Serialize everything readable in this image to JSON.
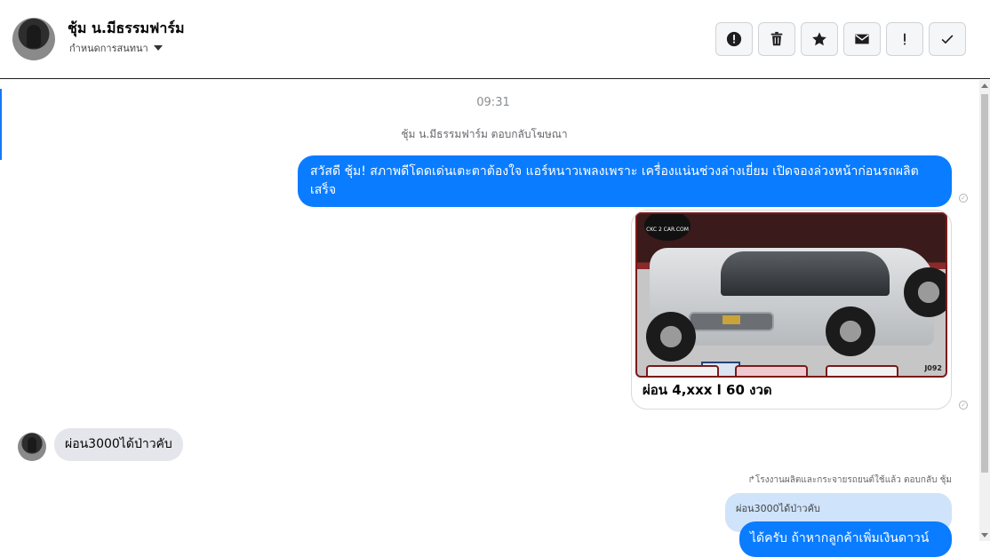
{
  "header": {
    "contact_name": "ชุ้ม น.มีธรรมฟาร์ม",
    "assign_label": "กำหนดการสนทนา",
    "toolbar": [
      {
        "name": "spam-button",
        "glyph": "!",
        "icon": "alert-circle-icon"
      },
      {
        "name": "delete-button",
        "glyph": "🗑",
        "icon": "trash-icon"
      },
      {
        "name": "star-button",
        "glyph": "★",
        "icon": "star-icon"
      },
      {
        "name": "mark-unread-button",
        "glyph": "✉",
        "icon": "envelope-icon"
      },
      {
        "name": "follow-up-button",
        "glyph": "!",
        "icon": "exclamation-icon"
      },
      {
        "name": "done-button",
        "glyph": "✓",
        "icon": "check-icon"
      }
    ]
  },
  "conversation": {
    "timestamp": "09:31",
    "ad_reply_note": "ชุ้ม น.มีธรรมฟาร์ม ตอบกลับโฆษณา",
    "outgoing_message_1": "สวัสดี ชุ้ม! สภาพดีโดดเด่นเตะตาต้องใจ แอร์หนาวเพลงเพราะ เครื่องแน่นช่วงล่างเยี่ยม เปิดจองล่วงหน้าก่อนรถผลิตเสร็จ",
    "ad_card": {
      "watermark": "CKC 2 CAR.COM",
      "code": "J092",
      "caption": "ผ่อน 4,xxx l 60 งวด"
    },
    "incoming_message_1": "ผ่อน3000ได้ป่าวคับ",
    "reply_note": "โรงงานผลิตและกระจายรถยนต์ใช้แล้ว ตอบกลับ ชุ้ม",
    "quoted_message": "ผ่อน3000ได้ป่าวคับ",
    "outgoing_message_2": "ได้ครับ ถ้าหากลูกค้าเพิ่มเงินดาวน์"
  },
  "colors": {
    "outgoing_bubble": "#0a7cff",
    "incoming_bubble": "#e4e6eb",
    "quoted_bubble": "#cfe3fb"
  }
}
